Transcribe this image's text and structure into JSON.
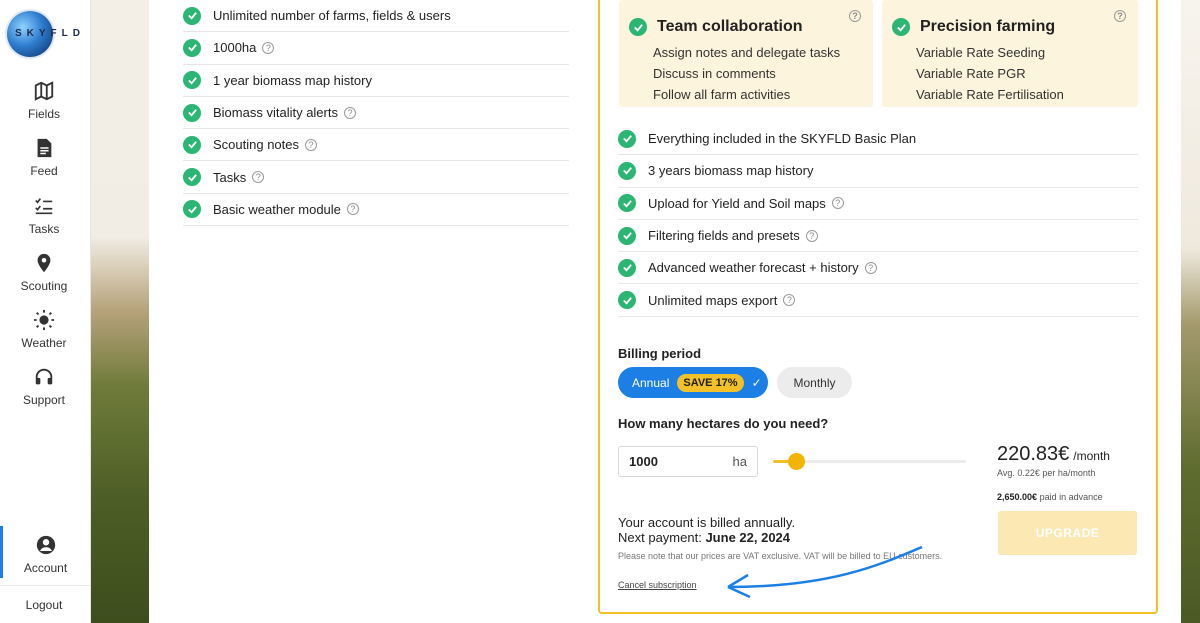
{
  "brand": {
    "logo_text": "SKYFLD"
  },
  "sidebar": {
    "items": [
      {
        "label": "Fields",
        "icon": "map-icon"
      },
      {
        "label": "Feed",
        "icon": "document-icon"
      },
      {
        "label": "Tasks",
        "icon": "checklist-icon"
      },
      {
        "label": "Scouting",
        "icon": "pin-icon"
      },
      {
        "label": "Weather",
        "icon": "sun-icon"
      },
      {
        "label": "Support",
        "icon": "headset-icon"
      }
    ],
    "account_label": "Account",
    "logout_label": "Logout"
  },
  "basic_features": [
    "Unlimited number of farms, fields & users",
    "1000ha",
    "1 year biomass map history",
    "Biomass vitality alerts",
    "Scouting notes",
    "Tasks",
    "Basic weather module"
  ],
  "addons": [
    {
      "title": "Team collaboration",
      "items": [
        "Assign notes and delegate tasks",
        "Discuss in comments",
        "Follow all farm activities"
      ]
    },
    {
      "title": "Precision farming",
      "items": [
        "Variable Rate Seeding",
        "Variable Rate PGR",
        "Variable Rate Fertilisation"
      ]
    }
  ],
  "plan_features": [
    "Everything included in the SKYFLD Basic Plan",
    "3 years biomass map history",
    "Upload for Yield and Soil maps",
    "Filtering fields and presets",
    "Advanced weather forecast + history",
    "Unlimited maps export"
  ],
  "billing": {
    "title": "Billing period",
    "annual_label": "Annual",
    "save_badge": "SAVE 17%",
    "monthly_label": "Monthly"
  },
  "hectares": {
    "title": "How many hectares do you need?",
    "value": "1000",
    "unit": "ha",
    "slider_fraction": 0.12
  },
  "pricing": {
    "price": "220.83€",
    "per": "/month",
    "per_ha": "Avg. 0.22€ per ha/month",
    "advance_amount": "2,650.00€",
    "advance_text": "paid in advance",
    "upgrade_label": "UPGRADE"
  },
  "account_billing": {
    "billed_text": "Your account is billed annually.",
    "next_payment_label": "Next payment:",
    "next_payment_date": "June 22, 2024",
    "vat_note": "Please note that our prices are VAT exclusive. VAT will be billed to EU customers.",
    "cancel_label": "Cancel subscription"
  },
  "colors": {
    "accent_blue": "#1b7fe6",
    "accent_yellow": "#f2c028",
    "check_green": "#2bb673",
    "addon_bg": "#fdf4dd"
  }
}
